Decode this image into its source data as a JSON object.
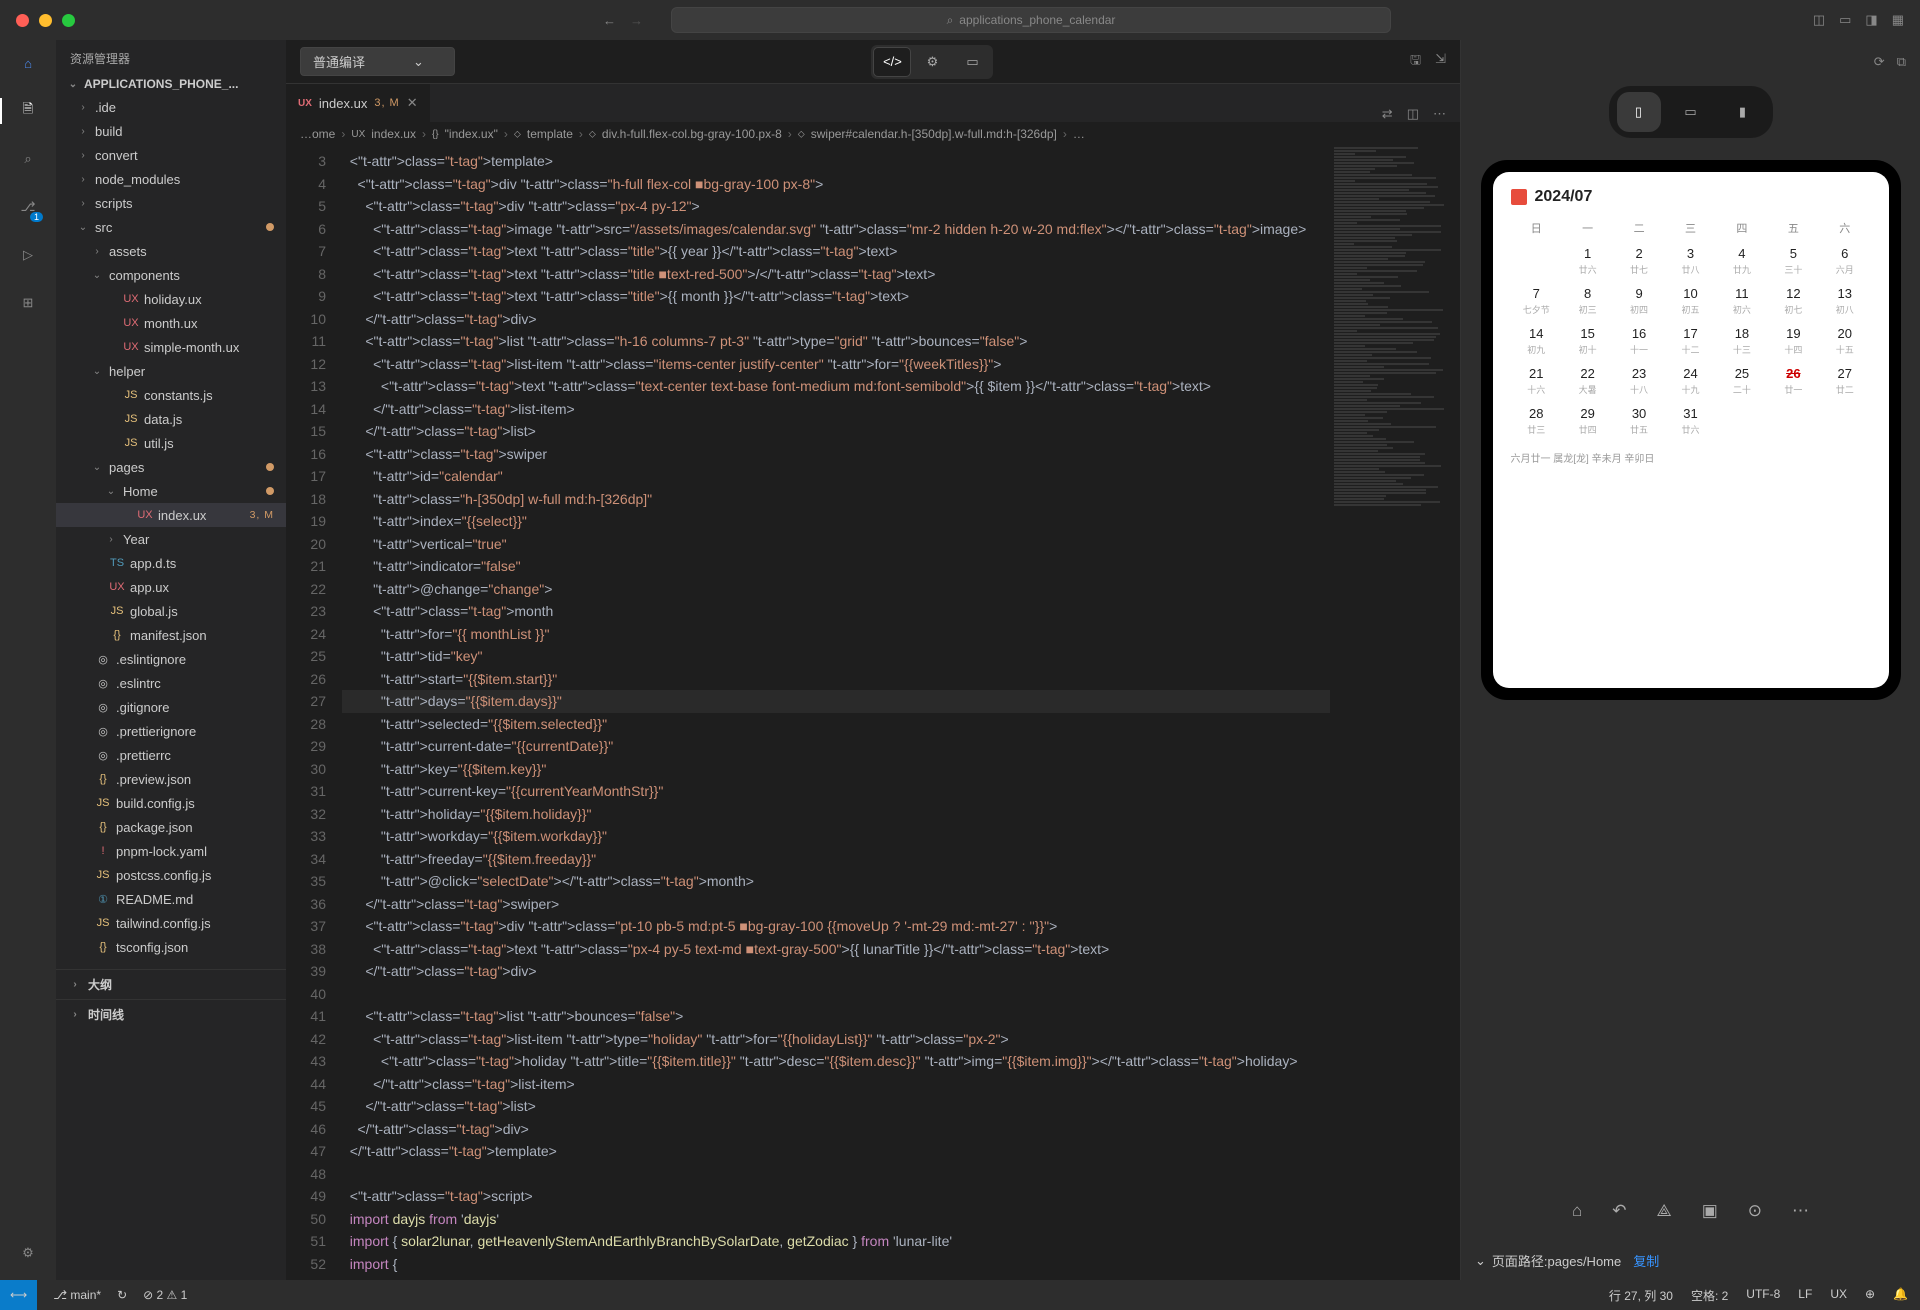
{
  "window": {
    "search_placeholder": "applications_phone_calendar"
  },
  "toolbar": {
    "combo_label": "普通编译"
  },
  "sidebar": {
    "header": "资源管理器",
    "root": "APPLICATIONS_PHONE_...",
    "sections": {
      "outline": "大纲",
      "timeline": "时间线"
    },
    "tree": [
      {
        "d": 1,
        "t": "folder",
        "n": ".ide",
        "c": true
      },
      {
        "d": 1,
        "t": "folder",
        "n": "build",
        "c": true
      },
      {
        "d": 1,
        "t": "folder",
        "n": "convert",
        "c": true
      },
      {
        "d": 1,
        "t": "folder",
        "n": "node_modules",
        "c": true
      },
      {
        "d": 1,
        "t": "folder",
        "n": "scripts",
        "c": true
      },
      {
        "d": 1,
        "t": "folder",
        "n": "src",
        "c": false,
        "mod": true
      },
      {
        "d": 2,
        "t": "folder",
        "n": "assets",
        "c": true
      },
      {
        "d": 2,
        "t": "folder",
        "n": "components",
        "c": false
      },
      {
        "d": 3,
        "t": "file",
        "n": "holiday.ux",
        "k": "ux"
      },
      {
        "d": 3,
        "t": "file",
        "n": "month.ux",
        "k": "ux"
      },
      {
        "d": 3,
        "t": "file",
        "n": "simple-month.ux",
        "k": "ux"
      },
      {
        "d": 2,
        "t": "folder",
        "n": "helper",
        "c": false
      },
      {
        "d": 3,
        "t": "file",
        "n": "constants.js",
        "k": "js"
      },
      {
        "d": 3,
        "t": "file",
        "n": "data.js",
        "k": "js"
      },
      {
        "d": 3,
        "t": "file",
        "n": "util.js",
        "k": "js"
      },
      {
        "d": 2,
        "t": "folder",
        "n": "pages",
        "c": false,
        "mod": true
      },
      {
        "d": 3,
        "t": "folder",
        "n": "Home",
        "c": false,
        "mod": true
      },
      {
        "d": 4,
        "t": "file",
        "n": "index.ux",
        "k": "ux",
        "sel": true,
        "tag": "3, M"
      },
      {
        "d": 3,
        "t": "folder",
        "n": "Year",
        "c": true
      },
      {
        "d": 2,
        "t": "file",
        "n": "app.d.ts",
        "k": "ts"
      },
      {
        "d": 2,
        "t": "file",
        "n": "app.ux",
        "k": "ux"
      },
      {
        "d": 2,
        "t": "file",
        "n": "global.js",
        "k": "js"
      },
      {
        "d": 2,
        "t": "file",
        "n": "manifest.json",
        "k": "json"
      },
      {
        "d": 1,
        "t": "file",
        "n": ".eslintignore",
        "k": "txt"
      },
      {
        "d": 1,
        "t": "file",
        "n": ".eslintrc",
        "k": "txt"
      },
      {
        "d": 1,
        "t": "file",
        "n": ".gitignore",
        "k": "txt"
      },
      {
        "d": 1,
        "t": "file",
        "n": ".prettierignore",
        "k": "txt"
      },
      {
        "d": 1,
        "t": "file",
        "n": ".prettierrc",
        "k": "txt"
      },
      {
        "d": 1,
        "t": "file",
        "n": ".preview.json",
        "k": "json"
      },
      {
        "d": 1,
        "t": "file",
        "n": "build.config.js",
        "k": "js"
      },
      {
        "d": 1,
        "t": "file",
        "n": "package.json",
        "k": "json"
      },
      {
        "d": 1,
        "t": "file",
        "n": "pnpm-lock.yaml",
        "k": "yml"
      },
      {
        "d": 1,
        "t": "file",
        "n": "postcss.config.js",
        "k": "js"
      },
      {
        "d": 1,
        "t": "file",
        "n": "README.md",
        "k": "md"
      },
      {
        "d": 1,
        "t": "file",
        "n": "tailwind.config.js",
        "k": "js"
      },
      {
        "d": 1,
        "t": "file",
        "n": "tsconfig.json",
        "k": "json"
      }
    ]
  },
  "tab": {
    "icon": "UX",
    "name": "index.ux",
    "status": "3, M"
  },
  "breadcrumb": [
    "…ome",
    "index.ux",
    "\"index.ux\"",
    "template",
    "div.h-full.flex-col.bg-gray-100.px-8",
    "swiper#calendar.h-[350dp].w-full.md:h-[326dp]",
    "…"
  ],
  "breadcrumb_icons": [
    "",
    "UX",
    "{}",
    "⬦",
    "⬦",
    "⬦",
    ""
  ],
  "code": {
    "start": 3,
    "lines": [
      "  <template>",
      "    <div class=\"h-full flex-col ■bg-gray-100 px-8\">",
      "      <div class=\"px-4 py-12\">",
      "        <image src=\"/assets/images/calendar.svg\" class=\"mr-2 hidden h-20 w-20 md:flex\"></image>",
      "        <text class=\"title\">{{ year }}</text>",
      "        <text class=\"title ■text-red-500\">/</text>",
      "        <text class=\"title\">{{ month }}</text>",
      "      </div>",
      "      <list class=\"h-16 columns-7 pt-3\" type=\"grid\" bounces=\"false\">",
      "        <list-item class=\"items-center justify-center\" for=\"{{weekTitles}}\">",
      "          <text class=\"text-center text-base font-medium md:font-semibold\">{{ $item }}</text>",
      "        </list-item>",
      "      </list>",
      "      <swiper",
      "        id=\"calendar\"",
      "        class=\"h-[350dp] w-full md:h-[326dp]\"",
      "        index=\"{{select}}\"",
      "        vertical=\"true\"",
      "        indicator=\"false\"",
      "        @change=\"change\">",
      "        <month",
      "          for=\"{{ monthList }}\"",
      "          tid=\"key\"",
      "          start=\"{{$item.start}}\"",
      "          days=\"{{$item.days}}\"",
      "          selected=\"{{$item.selected}}\"",
      "          current-date=\"{{currentDate}}\"",
      "          key=\"{{$item.key}}\"",
      "          current-key=\"{{currentYearMonthStr}}\"",
      "          holiday=\"{{$item.holiday}}\"",
      "          workday=\"{{$item.workday}}\"",
      "          freeday=\"{{$item.freeday}}\"",
      "          @click=\"selectDate\"></month>",
      "      </swiper>",
      "      <div class=\"pt-10 pb-5 md:pt-5 ■bg-gray-100 {{moveUp ? '-mt-29 md:-mt-27' : ''}}\">",
      "        <text class=\"px-4 py-5 text-md ■text-gray-500\">{{ lunarTitle }}</text>",
      "      </div>",
      "",
      "      <list bounces=\"false\">",
      "        <list-item type=\"holiday\" for=\"{{holidayList}}\" class=\"px-2\">",
      "          <holiday title=\"{{$item.title}}\" desc=\"{{$item.desc}}\" img=\"{{$item.img}}\"></holiday>",
      "        </list-item>",
      "      </list>",
      "    </div>",
      "  </template>",
      "",
      "  <script>",
      "  import dayjs from 'dayjs'",
      "  import { solar2lunar, getHeavenlyStemAndEarthlyBranchBySolarDate, getZodiac } from 'lunar-lite'",
      "  import {"
    ],
    "highlight_line": 27
  },
  "preview": {
    "title": "2024/07",
    "weekdays": [
      "日",
      "一",
      "二",
      "三",
      "四",
      "五",
      "六"
    ],
    "days": [
      [
        "",
        "1 廿六",
        "2 廿七",
        "3 廿八",
        "4 廿九",
        "5 三十",
        "6 六月"
      ],
      [
        "7 七夕节",
        "8 初三",
        "9 初四",
        "10 初五",
        "11 初六",
        "12 初七",
        "13 初八"
      ],
      [
        "14 初九",
        "15 初十",
        "16 十一",
        "17 十二",
        "18 十三",
        "19 十四",
        "20 十五"
      ],
      [
        "21 十六",
        "22 大暑",
        "23 十八",
        "24 十九",
        "25 二十",
        "26 廿一",
        "27 廿二"
      ],
      [
        "28 廿三",
        "29 廿四",
        "30 廿五",
        "31 廿六",
        "",
        "",
        ""
      ]
    ],
    "today": "26",
    "lunar": "六月廿一 属龙[龙] 辛未月 辛卯日",
    "path_label": "页面路径:pages/Home",
    "copy": "复制"
  },
  "status": {
    "branch": "main*",
    "sync": "↻",
    "errors": "⊘ 2 ⚠ 1",
    "cursor": "行 27, 列 30",
    "spaces": "空格: 2",
    "encoding": "UTF-8",
    "eol": "LF",
    "lang": "UX"
  }
}
